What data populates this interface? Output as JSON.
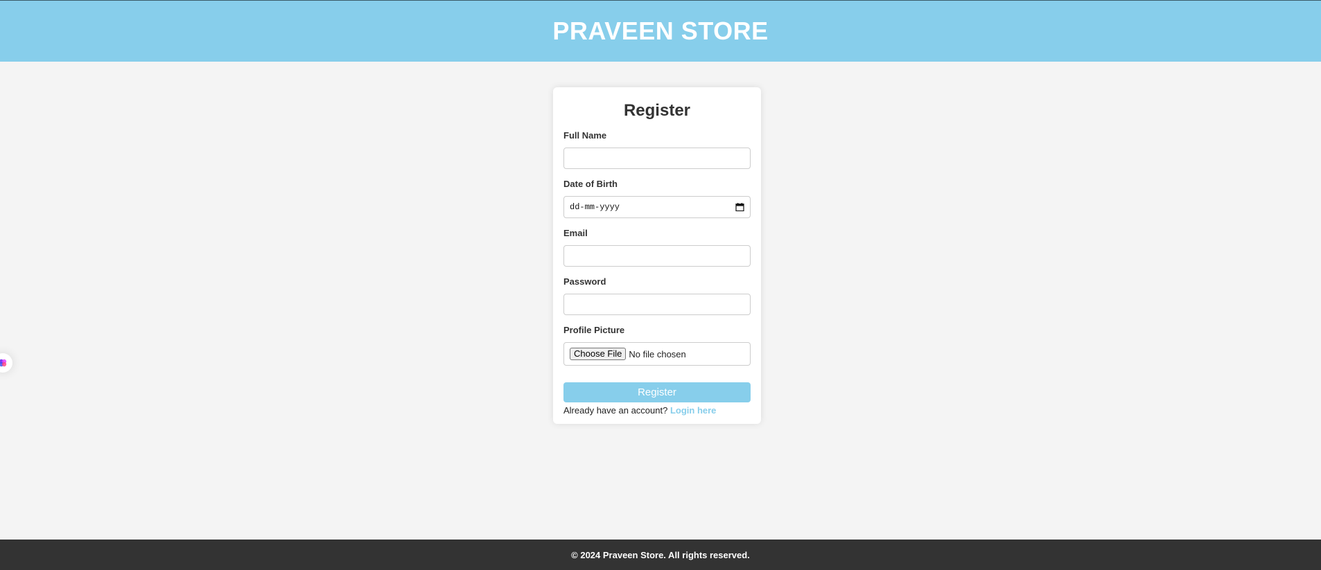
{
  "header": {
    "title": "PRAVEEN STORE"
  },
  "form": {
    "title": "Register",
    "fields": [
      {
        "label": "Full Name",
        "value": ""
      },
      {
        "label": "Date of Birth",
        "placeholder": "dd-mm-yyyy"
      },
      {
        "label": "Email",
        "value": ""
      },
      {
        "label": "Password",
        "value": ""
      },
      {
        "label": "Profile Picture",
        "button": "Choose File",
        "status": "No file chosen"
      }
    ],
    "submit_label": "Register",
    "login_prompt": "Already have an account?",
    "login_link": "Login here"
  },
  "footer": {
    "text": "© 2024 Praveen Store. All rights reserved."
  },
  "icons": {
    "calendar": "calendar-icon",
    "side_widget": "extension-icon"
  },
  "colors": {
    "accent": "#87ceeb",
    "footer_bg": "#333333",
    "page_bg": "#f4f4f4"
  }
}
